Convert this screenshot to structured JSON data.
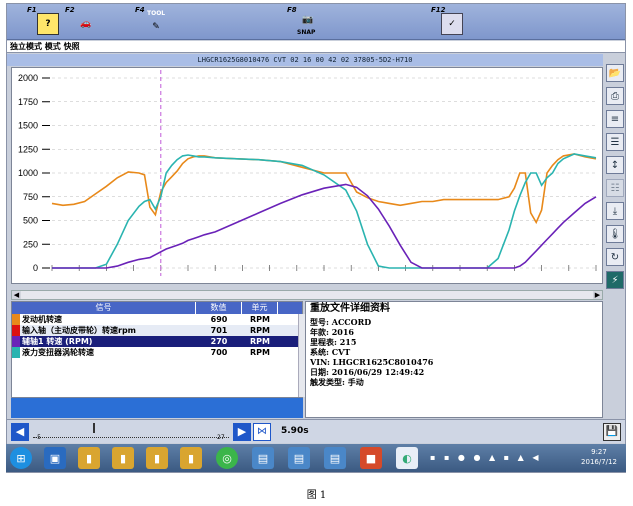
{
  "toolbar": {
    "keys": [
      {
        "key": "F1",
        "label": "",
        "icon": "help-icon"
      },
      {
        "key": "F2",
        "label": "",
        "icon": "car-icon"
      },
      {
        "key": "F4",
        "label": "TOOL",
        "icon": "tool-icon"
      },
      {
        "key": "F8",
        "label": "SNAP",
        "icon": "camera-icon"
      },
      {
        "key": "F12",
        "label": "",
        "icon": "exit-icon"
      }
    ]
  },
  "mode_text": "独立模式 模式 快照",
  "vin_bar": "LHGCR1625G8010476  CVT  02 16 00 42 02  37805-5D2-H710",
  "chart_data": {
    "type": "line",
    "ylim": [
      0,
      2000
    ],
    "yticks": [
      0,
      250,
      500,
      750,
      1000,
      1250,
      1500,
      1750,
      2000
    ],
    "xlim": [
      0,
      100
    ],
    "cursor_x": 20,
    "x": [
      0,
      2,
      4,
      6,
      8,
      10,
      12,
      14,
      16,
      17,
      18,
      19,
      20,
      21,
      22,
      23,
      24,
      25,
      26,
      27,
      28,
      30,
      34,
      38,
      42,
      46,
      50,
      54,
      56,
      58,
      60,
      62,
      64,
      66,
      68,
      70,
      72,
      74,
      76,
      78,
      80,
      82,
      84,
      85,
      86,
      87,
      88,
      89,
      90,
      91,
      92,
      93,
      94,
      96,
      98,
      100
    ],
    "series": [
      {
        "color": "#e8891a",
        "values": [
          680,
          660,
          670,
          700,
          780,
          860,
          950,
          1010,
          1000,
          980,
          640,
          560,
          800,
          900,
          960,
          1020,
          1100,
          1150,
          1170,
          1180,
          1180,
          1160,
          1150,
          1140,
          1120,
          1060,
          1000,
          1000,
          800,
          740,
          700,
          680,
          660,
          680,
          700,
          700,
          720,
          720,
          720,
          720,
          720,
          720,
          750,
          840,
          1000,
          1000,
          580,
          480,
          610,
          1000,
          1080,
          1140,
          1180,
          1200,
          1170,
          1150
        ],
        "name": ""
      },
      {
        "color": "#2ab4b0",
        "values": [
          0,
          0,
          0,
          0,
          0,
          40,
          250,
          500,
          650,
          700,
          720,
          620,
          750,
          1000,
          1080,
          1140,
          1180,
          1190,
          1180,
          1170,
          1170,
          1160,
          1150,
          1140,
          1120,
          1080,
          980,
          820,
          600,
          250,
          20,
          0,
          0,
          0,
          0,
          0,
          0,
          0,
          0,
          0,
          0,
          100,
          400,
          600,
          760,
          900,
          1000,
          1000,
          870,
          950,
          1000,
          1100,
          1150,
          1200,
          1180,
          1160
        ],
        "name": ""
      },
      {
        "color": "#6a22b8",
        "values": [
          0,
          0,
          0,
          0,
          0,
          0,
          20,
          60,
          90,
          100,
          110,
          140,
          170,
          200,
          220,
          240,
          260,
          290,
          310,
          330,
          350,
          380,
          480,
          580,
          680,
          770,
          840,
          880,
          850,
          760,
          620,
          440,
          240,
          60,
          0,
          0,
          0,
          0,
          0,
          0,
          0,
          0,
          0,
          0,
          20,
          60,
          120,
          180,
          240,
          300,
          360,
          420,
          480,
          580,
          680,
          750
        ],
        "name": ""
      }
    ]
  },
  "table": {
    "headers": [
      "信号",
      "数值",
      "单元"
    ],
    "rows": [
      {
        "name": "发动机转速",
        "value": "690",
        "unit": "RPM",
        "color": "#e8891a"
      },
      {
        "name": "输入轴（主动皮带轮）转速rpm",
        "value": "701",
        "unit": "RPM",
        "color": "#d11"
      },
      {
        "name": "辅轴1 转速 (RPM)",
        "value": "270",
        "unit": "RPM",
        "color": "#6a22b8"
      },
      {
        "name": "液力变扭器涡轮转速",
        "value": "700",
        "unit": "RPM",
        "color": "#2ab4b0"
      }
    ]
  },
  "info": {
    "title": "重放文件详细资料",
    "lines": [
      "型号: ACCORD",
      "年款: 2016",
      "里程表:  215",
      "系统: CVT",
      "VIN: LHGCR1625C8010476",
      "日期: 2016/06/29 12:49:42",
      "触发类型: 手动"
    ]
  },
  "playback": {
    "scale_min": "-5",
    "scale_max": "27",
    "time": "5.90s"
  },
  "taskbar": {
    "time": "9:27",
    "date": "2016/7/12"
  },
  "caption": "图 1"
}
